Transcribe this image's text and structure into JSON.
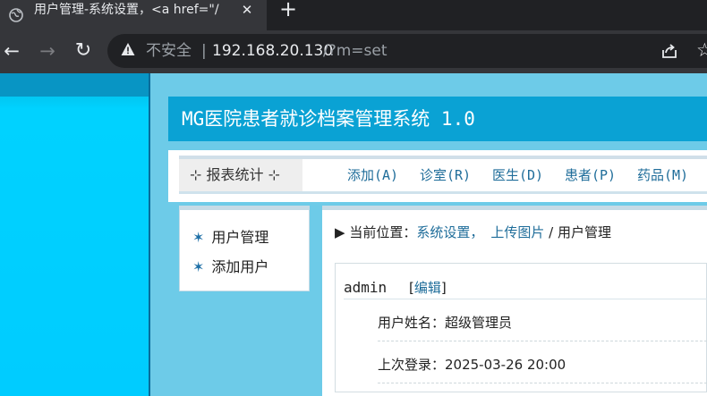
{
  "browser": {
    "tab_title": "用户管理-系统设置，<a href=\"/",
    "tab_close": "✕",
    "new_tab": "+",
    "back": "←",
    "forward": "→",
    "reload": "↻",
    "security_label": "不安全",
    "divider": "|",
    "url_host": "192.168.20.130",
    "url_path": "/?m=set",
    "star": "☆"
  },
  "site": {
    "title": "MG医院患者就诊档案管理系统 1.0"
  },
  "nav": {
    "report": "⊹ 报表统计 ⊹",
    "links": [
      "添加(A)",
      "诊室(R)",
      "医生(D)",
      "患者(P)",
      "药品(M)"
    ]
  },
  "sidebar": {
    "star": "✶",
    "items": [
      "用户管理",
      "添加用户"
    ]
  },
  "breadcrumb": {
    "arrow": "▶",
    "label": "当前位置：",
    "link1": "系统设置，",
    "link2": "上传图片",
    "sep": " / ",
    "current": "用户管理"
  },
  "user": {
    "name": "admin",
    "edit_open": "[",
    "edit_label": "编辑",
    "edit_close": "]",
    "realname_row": "用户姓名：超级管理员",
    "lastlogin_row": "上次登录：2025-03-26 20:00"
  }
}
